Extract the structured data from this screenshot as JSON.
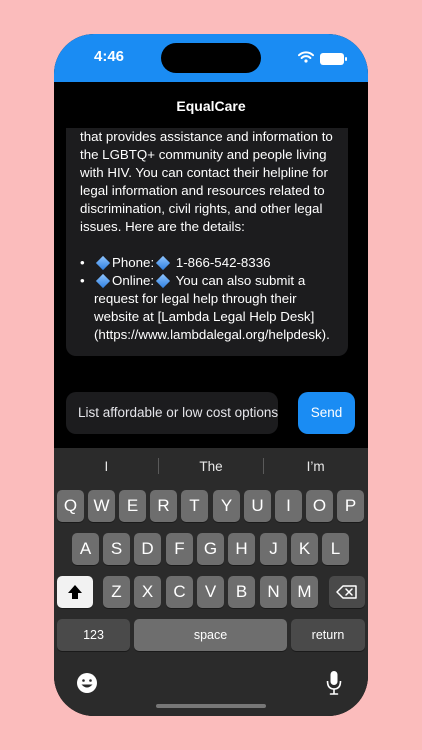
{
  "status": {
    "time": "4:46"
  },
  "nav": {
    "title": "EqualCare"
  },
  "message": {
    "intro": "that provides assistance and information to the LGBTQ+ community and people living with HIV. You can contact their helpline for legal information and resources related to discrimination, civil rights, and other legal issues. Here are the details:",
    "items": [
      {
        "label": "Phone:",
        "text": "1-866-542-8336"
      },
      {
        "label": "Online:",
        "text": "You can also submit a request for legal help through their website at [Lambda Legal Help Desk](https://www.lambdalegal.org/helpdesk)."
      }
    ]
  },
  "input": {
    "value": "List affordable or low cost options"
  },
  "send_label": "Send",
  "keyboard": {
    "suggestions": [
      "I",
      "The",
      "I’m"
    ],
    "row1": [
      "Q",
      "W",
      "E",
      "R",
      "T",
      "Y",
      "U",
      "I",
      "O",
      "P"
    ],
    "row2": [
      "A",
      "S",
      "D",
      "F",
      "G",
      "H",
      "J",
      "K",
      "L"
    ],
    "row3": [
      "Z",
      "X",
      "C",
      "V",
      "B",
      "N",
      "M"
    ],
    "numbers_label": "123",
    "space_label": "space",
    "return_label": "return"
  },
  "colors": {
    "accent": "#1a8cf3",
    "background": "#fbbcbc"
  }
}
